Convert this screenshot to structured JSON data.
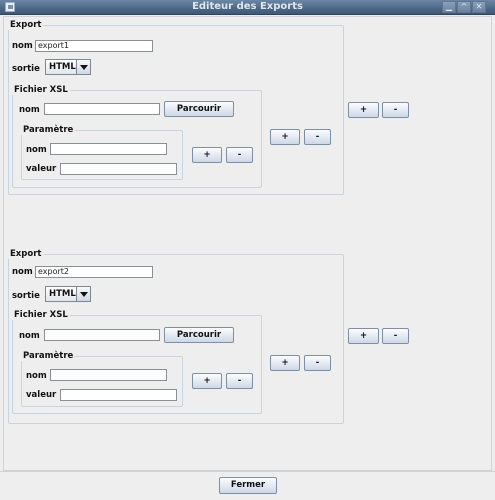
{
  "window": {
    "title": "Editeur des Exports"
  },
  "exports": [
    {
      "group_label": "Export",
      "nom_label": "nom",
      "nom_value": "export1",
      "sortie_label": "sortie",
      "sortie_value": "HTML",
      "xsl": {
        "group_label": "Fichier XSL",
        "nom_label": "nom",
        "nom_value": "",
        "browse_label": "Parcourir",
        "param": {
          "group_label": "Paramètre",
          "nom_label": "nom",
          "nom_value": "",
          "valeur_label": "valeur",
          "valeur_value": ""
        }
      },
      "param_add": "+",
      "param_remove": "-",
      "xsl_add": "+",
      "xsl_remove": "-",
      "export_add": "+",
      "export_remove": "-"
    },
    {
      "group_label": "Export",
      "nom_label": "nom",
      "nom_value": "export2",
      "sortie_label": "sortie",
      "sortie_value": "HTML",
      "xsl": {
        "group_label": "Fichier XSL",
        "nom_label": "nom",
        "nom_value": "",
        "browse_label": "Parcourir",
        "param": {
          "group_label": "Paramètre",
          "nom_label": "nom",
          "nom_value": "",
          "valeur_label": "valeur",
          "valeur_value": ""
        }
      },
      "param_add": "+",
      "param_remove": "-",
      "xsl_add": "+",
      "xsl_remove": "-",
      "export_add": "+",
      "export_remove": "-"
    }
  ],
  "footer": {
    "close_label": "Fermer"
  }
}
